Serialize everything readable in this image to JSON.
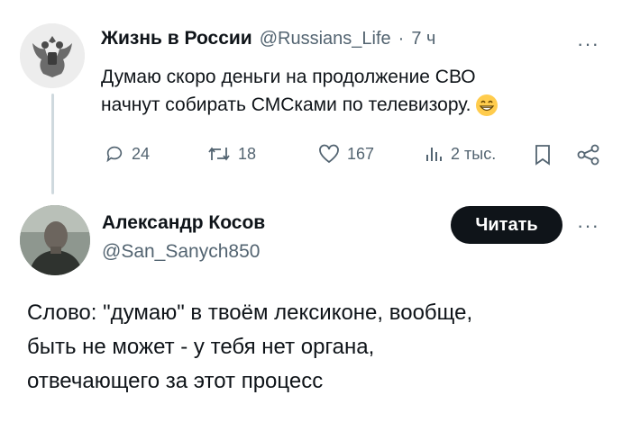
{
  "tweet": {
    "author_name": "Жизнь в России",
    "author_handle": "@Russians_Life",
    "separator": "·",
    "time": "7 ч",
    "more": "···",
    "text_line1": "Думаю скоро деньги на продолжение СВО",
    "text_line2": "начнут собирать СМСками по телевизору.",
    "emoji": "😁",
    "actions": {
      "replies": "24",
      "retweets": "18",
      "likes": "167",
      "views": "2 тыс."
    }
  },
  "reply": {
    "author_name": "Александр Косов",
    "author_handle": "@San_Sanych850",
    "follow_label": "Читать",
    "more": "···",
    "text_line1": "Слово: \"думаю\" в твоём лексиконе, вообще,",
    "text_line2": "быть не может - у тебя нет органа,",
    "text_line3": "отвечающего за этот процесс"
  }
}
